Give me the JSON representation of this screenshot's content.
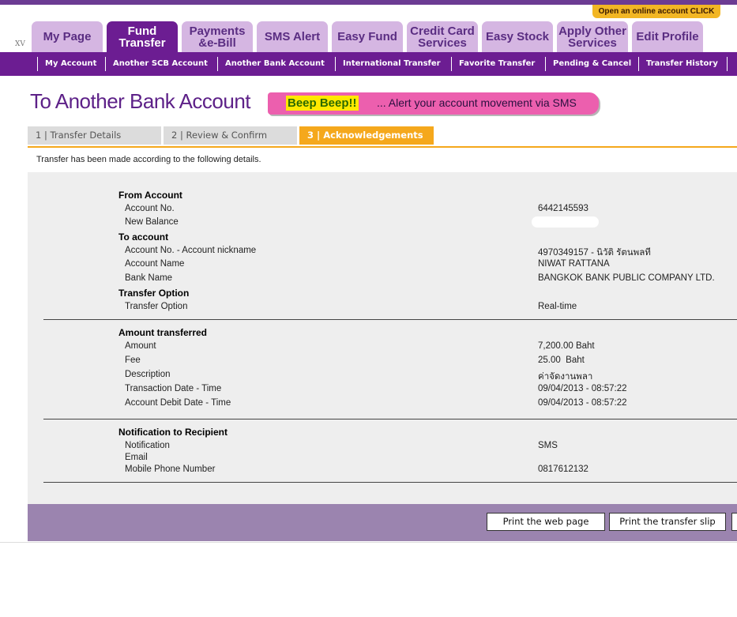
{
  "header": {
    "corner_text": "XV",
    "promo": "Open an online account CLICK",
    "tabs": [
      {
        "label": "My Page"
      },
      {
        "label": "Fund\nTransfer"
      },
      {
        "label": "Payments\n&e-Bill"
      },
      {
        "label": "SMS Alert"
      },
      {
        "label": "Easy Fund"
      },
      {
        "label": "Credit Card\nServices"
      },
      {
        "label": "Easy Stock"
      },
      {
        "label": "Apply Other\nServices"
      },
      {
        "label": "Edit Profile"
      }
    ],
    "active_tab": "Fund Transfer"
  },
  "subnav": {
    "items": [
      {
        "label": "My Account"
      },
      {
        "label": "Another SCB Account"
      },
      {
        "label": "Another Bank Account"
      },
      {
        "label": "International Transfer"
      },
      {
        "label": "Favorite Transfer"
      },
      {
        "label": "Pending & Cancel"
      },
      {
        "label": "Transfer History"
      }
    ]
  },
  "page": {
    "title": "To Another Bank Account",
    "banner_highlight": "Beep Beep!!",
    "banner_text": "... Alert your account movement via SMS"
  },
  "steps": [
    {
      "label": "1 | Transfer Details"
    },
    {
      "label": "2 | Review & Confirm"
    },
    {
      "label": "3 | Acknowledgements"
    }
  ],
  "active_step": 3,
  "intro": "Transfer has been made according to the following details.",
  "details": {
    "from_account": {
      "heading": "From Account",
      "account_no_label": "Account No.",
      "account_no": "6442145593",
      "new_balance_label": "New Balance"
    },
    "to_account": {
      "heading": "To account",
      "account_nick_label": "Account No. - Account nickname",
      "account_nick": "4970349157 - นิวัติ รัตนพลที",
      "account_name_label": "Account Name",
      "account_name": "NIWAT RATTANA",
      "bank_name_label": "Bank Name",
      "bank_name": "BANGKOK BANK PUBLIC COMPANY LTD."
    },
    "transfer_option": {
      "heading": "Transfer Option",
      "label": "Transfer Option",
      "value": "Real-time"
    },
    "amount": {
      "heading": "Amount transferred",
      "amount_label": "Amount",
      "amount": "7,200.00 Baht",
      "fee_label": "Fee",
      "fee": "25.00  Baht",
      "description_label": "Description",
      "description": "ค่าจัดงานพลา",
      "txn_label": "Transaction Date - Time",
      "txn": "09/04/2013 - 08:57:22",
      "debit_label": "Account Debit Date - Time",
      "debit": "09/04/2013 - 08:57:22"
    },
    "notification": {
      "heading": "Notification to Recipient",
      "notification_label": "Notification",
      "notification": "SMS",
      "email_label": "Email",
      "mobile_label": "Mobile Phone Number",
      "mobile": "0817612132"
    }
  },
  "footer": {
    "print_page": "Print the web page",
    "print_slip": "Print the transfer slip"
  },
  "colors": {
    "brand_purple": "#6c1d92",
    "tab_light": "#d5b6e2",
    "step_accent": "#f5a81c",
    "banner_pink": "#ec5fae",
    "footer_purple": "#9b84af"
  }
}
